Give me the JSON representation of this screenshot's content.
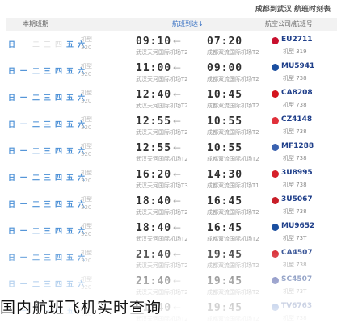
{
  "header": {
    "title": "成都到武汉 航班时刻表",
    "col_days": "本期班期",
    "col_arrive": "航班到达",
    "col_arrive_arrow": "↓",
    "col_flight": "航空公司/航班号"
  },
  "weekday_labels": [
    "日",
    "一",
    "二",
    "三",
    "四",
    "五",
    "六"
  ],
  "arrow_glyph": "←",
  "flights": [
    {
      "days": [
        1,
        0,
        0,
        0,
        0,
        1,
        1
      ],
      "model1": "机型",
      "model2": "320",
      "arrive_time": "09:10",
      "arrive_port": "武汉天河国际机场T2",
      "depart_time": "07:20",
      "depart_port": "成都双流国际机场T2",
      "logo_color": "#c8102e",
      "flight_no": "EU2711",
      "flight_sub": "机型 319"
    },
    {
      "days": [
        1,
        1,
        1,
        1,
        1,
        1,
        1
      ],
      "model1": "机型",
      "model2": "320",
      "arrive_time": "11:00",
      "arrive_port": "武汉天河国际机场T2",
      "depart_time": "09:00",
      "depart_port": "成都双流国际机场T2",
      "logo_color": "#1b4fa0",
      "flight_no": "MU5941",
      "flight_sub": "机型 738"
    },
    {
      "days": [
        1,
        1,
        1,
        1,
        1,
        1,
        1
      ],
      "model1": "机型",
      "model2": "320",
      "arrive_time": "12:40",
      "arrive_port": "武汉天河国际机场T2",
      "depart_time": "10:45",
      "depart_port": "成都双流国际机场T2",
      "logo_color": "#d4141e",
      "flight_no": "CA8208",
      "flight_sub": "机型 738"
    },
    {
      "days": [
        1,
        1,
        1,
        1,
        1,
        1,
        1
      ],
      "model1": "机型",
      "model2": "320",
      "arrive_time": "12:55",
      "arrive_port": "武汉天河国际机场T2",
      "depart_time": "10:55",
      "depart_port": "成都双流国际机场T2",
      "logo_color": "#e0303a",
      "flight_no": "CZ4148",
      "flight_sub": "机型 738"
    },
    {
      "days": [
        1,
        1,
        1,
        1,
        1,
        1,
        1
      ],
      "model1": "机型",
      "model2": "320",
      "arrive_time": "12:55",
      "arrive_port": "武汉天河国际机场T2",
      "depart_time": "10:55",
      "depart_port": "成都双流国际机场T2",
      "logo_color": "#3a62b0",
      "flight_no": "MF1288",
      "flight_sub": "机型 738"
    },
    {
      "days": [
        1,
        1,
        1,
        1,
        1,
        1,
        1
      ],
      "model1": "机型",
      "model2": "320",
      "arrive_time": "16:20",
      "arrive_port": "武汉天河国际机场T3",
      "depart_time": "14:30",
      "depart_port": "成都双流国际机场T1",
      "logo_color": "#d6202a",
      "flight_no": "3U8995",
      "flight_sub": "机型 738"
    },
    {
      "days": [
        1,
        1,
        1,
        1,
        1,
        1,
        1
      ],
      "model1": "机型",
      "model2": "320",
      "arrive_time": "18:40",
      "arrive_port": "武汉天河国际机场T2",
      "depart_time": "16:45",
      "depart_port": "成都双流国际机场T2",
      "logo_color": "#c81e28",
      "flight_no": "3U5067",
      "flight_sub": "机型 738"
    },
    {
      "days": [
        1,
        1,
        1,
        1,
        1,
        1,
        1
      ],
      "model1": "机型",
      "model2": "320",
      "arrive_time": "18:40",
      "arrive_port": "武汉天河国际机场T2",
      "depart_time": "16:45",
      "depart_port": "成都双流国际机场T2",
      "logo_color": "#1b4fa0",
      "flight_no": "MU9652",
      "flight_sub": "机型 73T"
    },
    {
      "days": [
        1,
        1,
        1,
        1,
        1,
        1,
        1
      ],
      "model1": "机型",
      "model2": "320",
      "arrive_time": "21:40",
      "arrive_port": "武汉天河国际机场T2",
      "depart_time": "19:45",
      "depart_port": "成都双流国际机场T2",
      "logo_color": "#d4141e",
      "flight_no": "CA4507",
      "flight_sub": "机型 738"
    },
    {
      "days": [
        1,
        1,
        1,
        1,
        1,
        1,
        1
      ],
      "model1": "机型",
      "model2": "320",
      "arrive_time": "21:40",
      "arrive_port": "武汉天河国际机场T2",
      "depart_time": "19:45",
      "depart_port": "成都双流国际机场T2",
      "logo_color": "#1e2f8f",
      "flight_no": "SC4507",
      "flight_sub": "机型 73T"
    },
    {
      "days": [
        0,
        1,
        1,
        1,
        1,
        1,
        0
      ],
      "model1": "机型",
      "model2": "320",
      "arrive_time": "21:40",
      "arrive_port": "武汉天河国际机场T2",
      "depart_time": "19:45",
      "depart_port": "成都双流国际机场T2",
      "logo_color": "#2a5cb8",
      "flight_no": "TV6763",
      "flight_sub": "机型 738"
    }
  ],
  "caption": "国内航班飞机实时查询"
}
